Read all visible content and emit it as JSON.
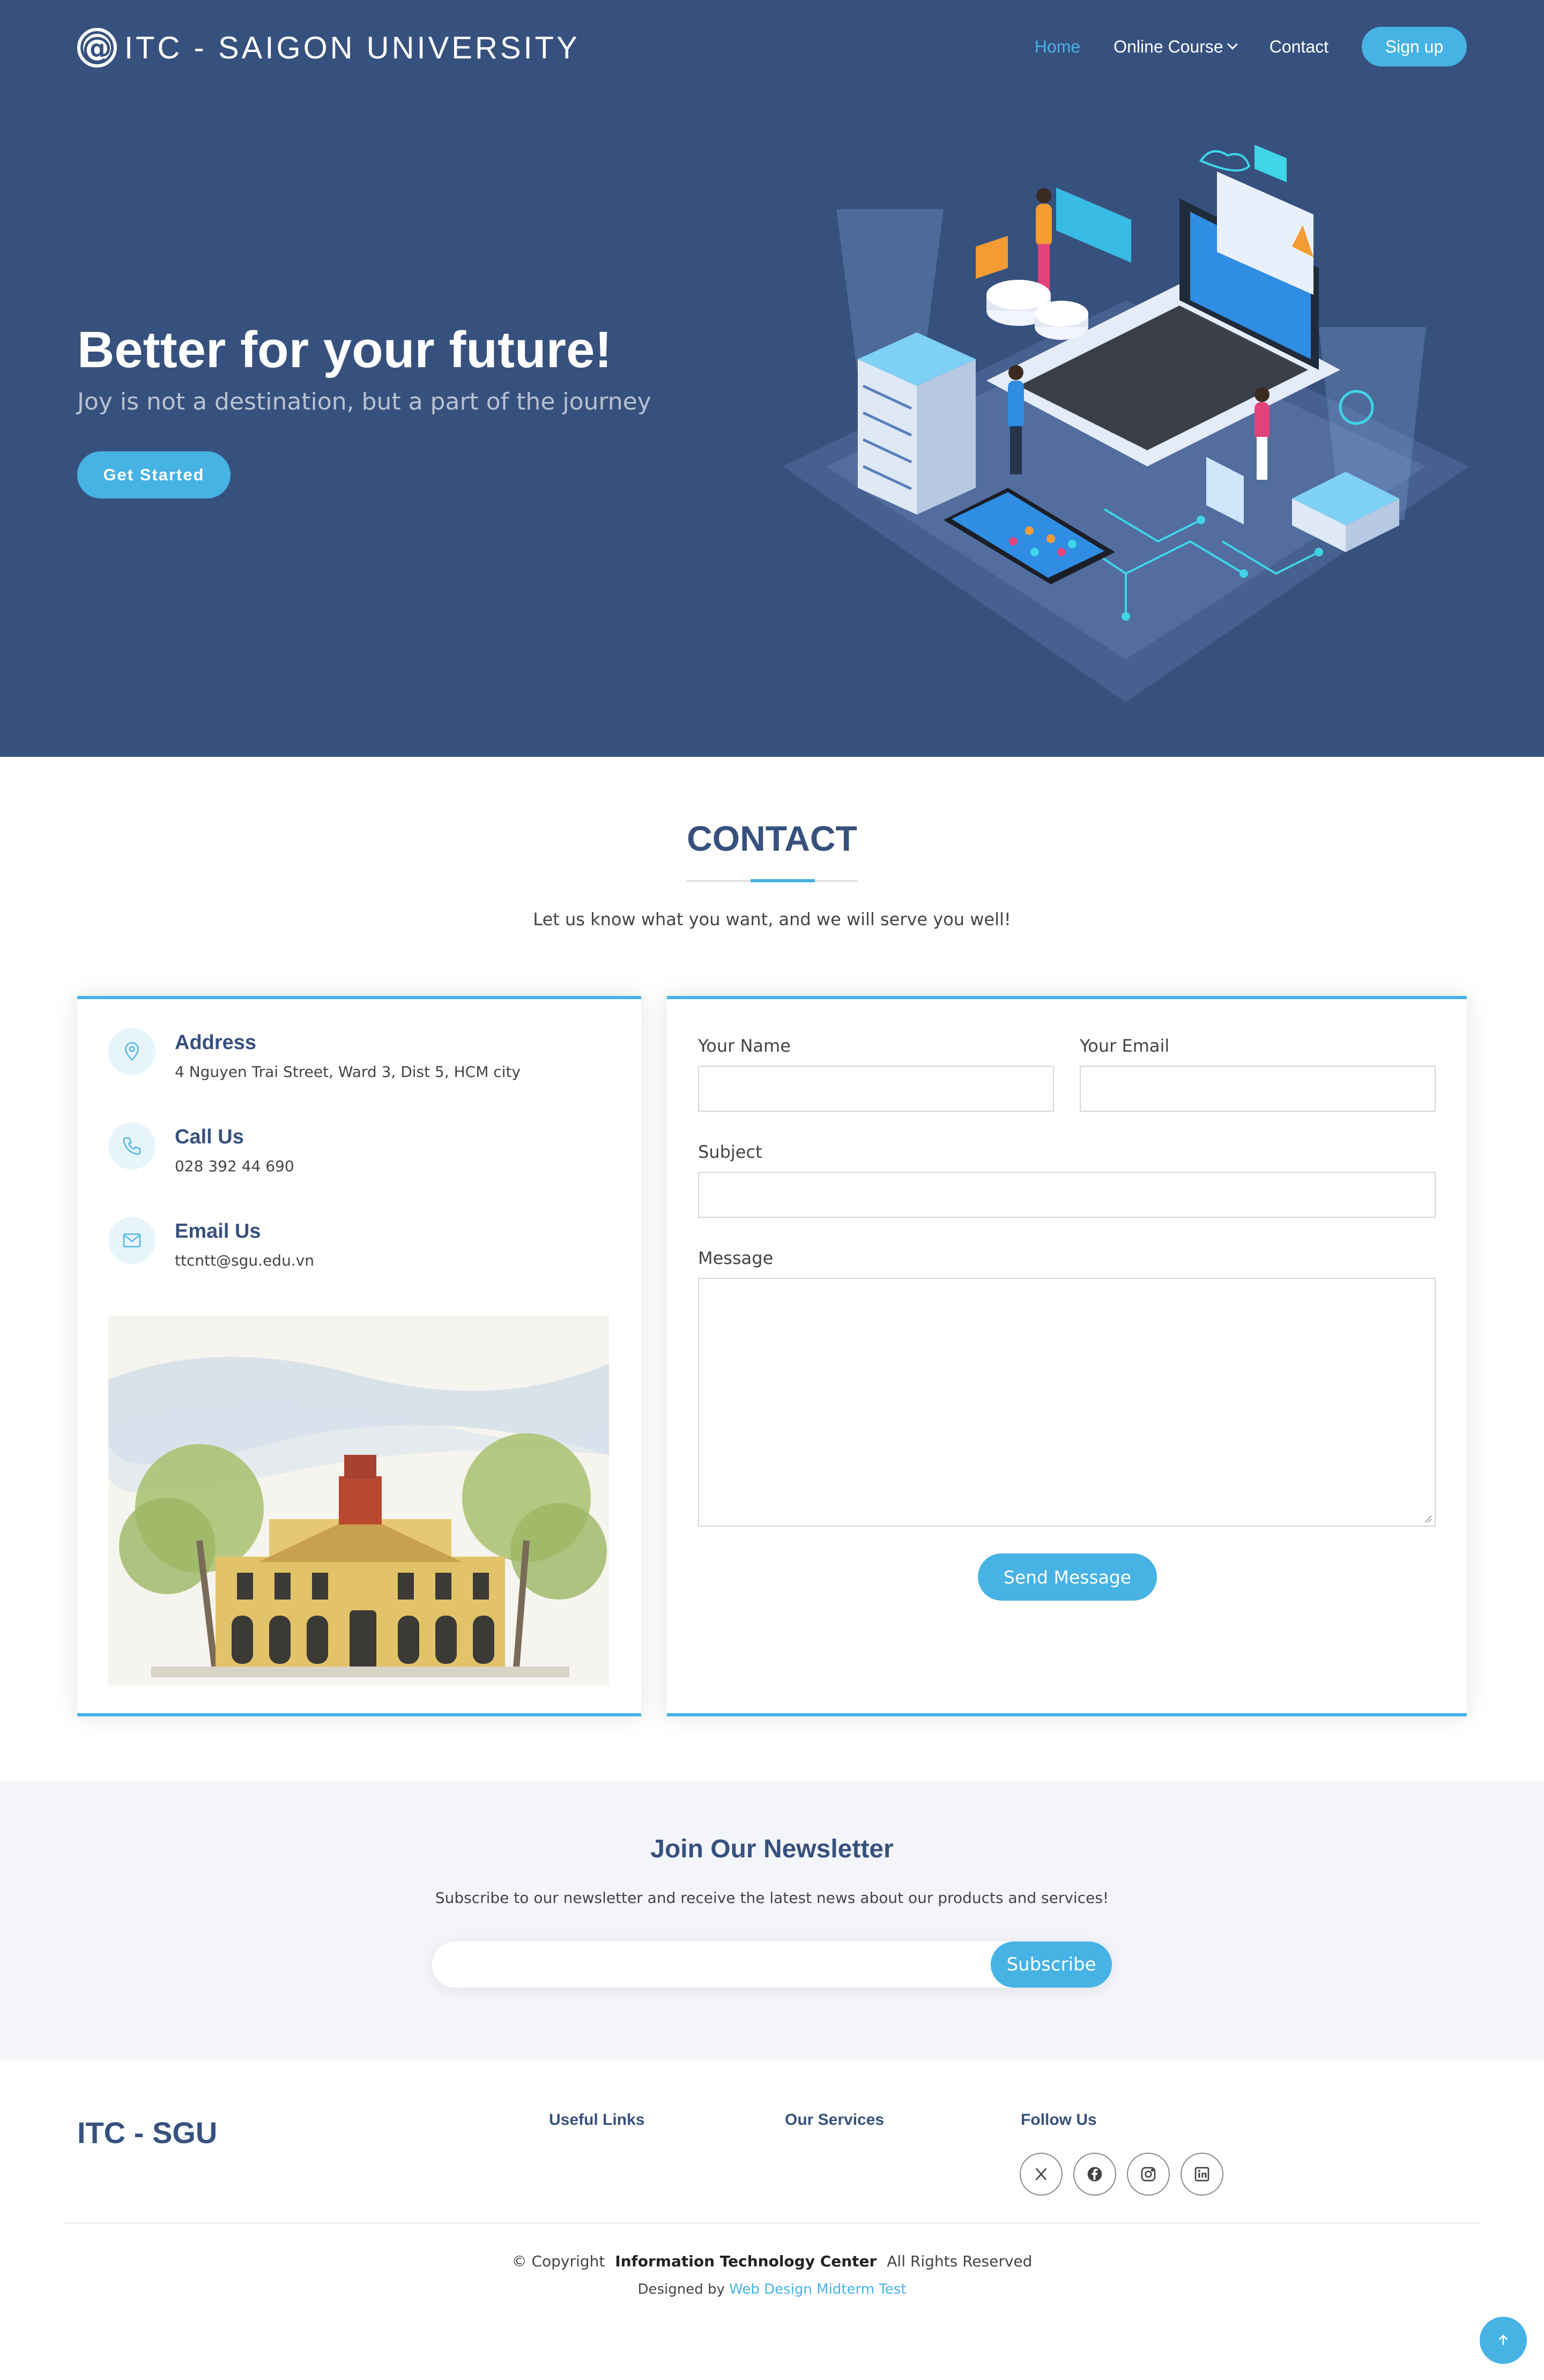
{
  "header": {
    "logo_mark": "@",
    "brand": "ITC - SAIGON UNIVERSITY",
    "nav": [
      {
        "label": "Home",
        "active": true
      },
      {
        "label": "Online Course",
        "has_dropdown": true
      },
      {
        "label": "Contact"
      }
    ],
    "signup_label": "Sign up"
  },
  "hero": {
    "title": "Better for your future!",
    "subtitle": "Joy is not a destination, but a part of the journey",
    "cta_label": "Get Started"
  },
  "contact": {
    "title": "CONTACT",
    "description": "Let us know what you want, and we will serve you well!",
    "info": [
      {
        "icon": "map-pin-icon",
        "label": "Address",
        "value": "4 Nguyen Trai Street, Ward 3, Dist 5, HCM city"
      },
      {
        "icon": "phone-icon",
        "label": "Call Us",
        "value": "028 392 44 690"
      },
      {
        "icon": "envelope-icon",
        "label": "Email Us",
        "value": "ttcntt@sgu.edu.vn"
      }
    ],
    "form": {
      "name_label": "Your Name",
      "email_label": "Your Email",
      "subject_label": "Subject",
      "message_label": "Message",
      "submit_label": "Send Message"
    }
  },
  "newsletter": {
    "title": "Join Our Newsletter",
    "description": "Subscribe to our newsletter and receive the latest news about our products and services!",
    "button_label": "Subscribe"
  },
  "footer": {
    "brand": "ITC - SGU",
    "columns": [
      "Useful Links",
      "Our Services",
      "Follow Us"
    ],
    "socials": [
      "x-icon",
      "facebook-icon",
      "instagram-icon",
      "linkedin-icon"
    ],
    "copyright_prefix": "© Copyright",
    "copyright_org": "Information Technology Center",
    "copyright_suffix": "All Rights Reserved",
    "credits_prefix": "Designed by",
    "credits_link": "Web Design Midterm Test"
  },
  "colors": {
    "primary": "#37517e",
    "accent": "#47b2e4",
    "newsletter_bg": "#f3f5fa"
  }
}
